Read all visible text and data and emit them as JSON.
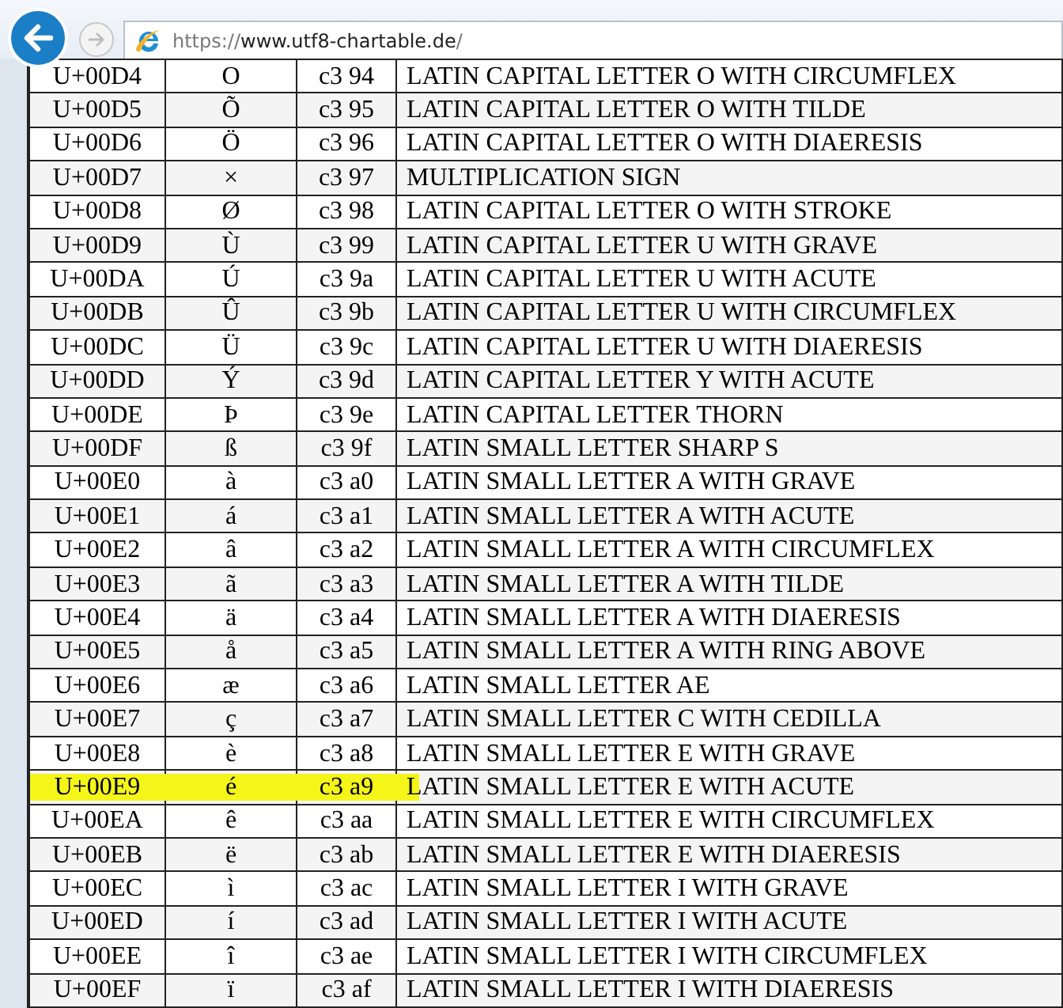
{
  "browser": {
    "url_scheme": "https://",
    "url_host": "www.utf8-chartable.de",
    "url_path": "/"
  },
  "table": {
    "rows": [
      {
        "code": "U+00D4",
        "char": "O",
        "utf8": "c3 94",
        "name": "LATIN CAPITAL LETTER O WITH CIRCUMFLEX",
        "highlighted": false
      },
      {
        "code": "U+00D5",
        "char": "Õ",
        "utf8": "c3 95",
        "name": "LATIN CAPITAL LETTER O WITH TILDE",
        "highlighted": false
      },
      {
        "code": "U+00D6",
        "char": "Ö",
        "utf8": "c3 96",
        "name": "LATIN CAPITAL LETTER O WITH DIAERESIS",
        "highlighted": false
      },
      {
        "code": "U+00D7",
        "char": "×",
        "utf8": "c3 97",
        "name": "MULTIPLICATION SIGN",
        "highlighted": false
      },
      {
        "code": "U+00D8",
        "char": "Ø",
        "utf8": "c3 98",
        "name": "LATIN CAPITAL LETTER O WITH STROKE",
        "highlighted": false
      },
      {
        "code": "U+00D9",
        "char": "Ù",
        "utf8": "c3 99",
        "name": "LATIN CAPITAL LETTER U WITH GRAVE",
        "highlighted": false
      },
      {
        "code": "U+00DA",
        "char": "Ú",
        "utf8": "c3 9a",
        "name": "LATIN CAPITAL LETTER U WITH ACUTE",
        "highlighted": false
      },
      {
        "code": "U+00DB",
        "char": "Û",
        "utf8": "c3 9b",
        "name": "LATIN CAPITAL LETTER U WITH CIRCUMFLEX",
        "highlighted": false
      },
      {
        "code": "U+00DC",
        "char": "Ü",
        "utf8": "c3 9c",
        "name": "LATIN CAPITAL LETTER U WITH DIAERESIS",
        "highlighted": false
      },
      {
        "code": "U+00DD",
        "char": "Ý",
        "utf8": "c3 9d",
        "name": "LATIN CAPITAL LETTER Y WITH ACUTE",
        "highlighted": false
      },
      {
        "code": "U+00DE",
        "char": "Þ",
        "utf8": "c3 9e",
        "name": "LATIN CAPITAL LETTER THORN",
        "highlighted": false
      },
      {
        "code": "U+00DF",
        "char": "ß",
        "utf8": "c3 9f",
        "name": "LATIN SMALL LETTER SHARP S",
        "highlighted": false
      },
      {
        "code": "U+00E0",
        "char": "à",
        "utf8": "c3 a0",
        "name": "LATIN SMALL LETTER A WITH GRAVE",
        "highlighted": false
      },
      {
        "code": "U+00E1",
        "char": "á",
        "utf8": "c3 a1",
        "name": "LATIN SMALL LETTER A WITH ACUTE",
        "highlighted": false
      },
      {
        "code": "U+00E2",
        "char": "â",
        "utf8": "c3 a2",
        "name": "LATIN SMALL LETTER A WITH CIRCUMFLEX",
        "highlighted": false
      },
      {
        "code": "U+00E3",
        "char": "ã",
        "utf8": "c3 a3",
        "name": "LATIN SMALL LETTER A WITH TILDE",
        "highlighted": false
      },
      {
        "code": "U+00E4",
        "char": "ä",
        "utf8": "c3 a4",
        "name": "LATIN SMALL LETTER A WITH DIAERESIS",
        "highlighted": false
      },
      {
        "code": "U+00E5",
        "char": "å",
        "utf8": "c3 a5",
        "name": "LATIN SMALL LETTER A WITH RING ABOVE",
        "highlighted": false
      },
      {
        "code": "U+00E6",
        "char": "æ",
        "utf8": "c3 a6",
        "name": "LATIN SMALL LETTER AE",
        "highlighted": false
      },
      {
        "code": "U+00E7",
        "char": "ç",
        "utf8": "c3 a7",
        "name": "LATIN SMALL LETTER C WITH CEDILLA",
        "highlighted": false
      },
      {
        "code": "U+00E8",
        "char": "è",
        "utf8": "c3 a8",
        "name": "LATIN SMALL LETTER E WITH GRAVE",
        "highlighted": false
      },
      {
        "code": "U+00E9",
        "char": "é",
        "utf8": "c3 a9",
        "name": "LATIN SMALL LETTER E WITH ACUTE",
        "highlighted": true
      },
      {
        "code": "U+00EA",
        "char": "ê",
        "utf8": "c3 aa",
        "name": "LATIN SMALL LETTER E WITH CIRCUMFLEX",
        "highlighted": false
      },
      {
        "code": "U+00EB",
        "char": "ë",
        "utf8": "c3 ab",
        "name": "LATIN SMALL LETTER E WITH DIAERESIS",
        "highlighted": false
      },
      {
        "code": "U+00EC",
        "char": "ì",
        "utf8": "c3 ac",
        "name": "LATIN SMALL LETTER I WITH GRAVE",
        "highlighted": false
      },
      {
        "code": "U+00ED",
        "char": "í",
        "utf8": "c3 ad",
        "name": "LATIN SMALL LETTER I WITH ACUTE",
        "highlighted": false
      },
      {
        "code": "U+00EE",
        "char": "î",
        "utf8": "c3 ae",
        "name": "LATIN SMALL LETTER I WITH CIRCUMFLEX",
        "highlighted": false
      },
      {
        "code": "U+00EF",
        "char": "ï",
        "utf8": "c3 af",
        "name": "LATIN SMALL LETTER I WITH DIAERESIS",
        "highlighted": false
      }
    ]
  }
}
